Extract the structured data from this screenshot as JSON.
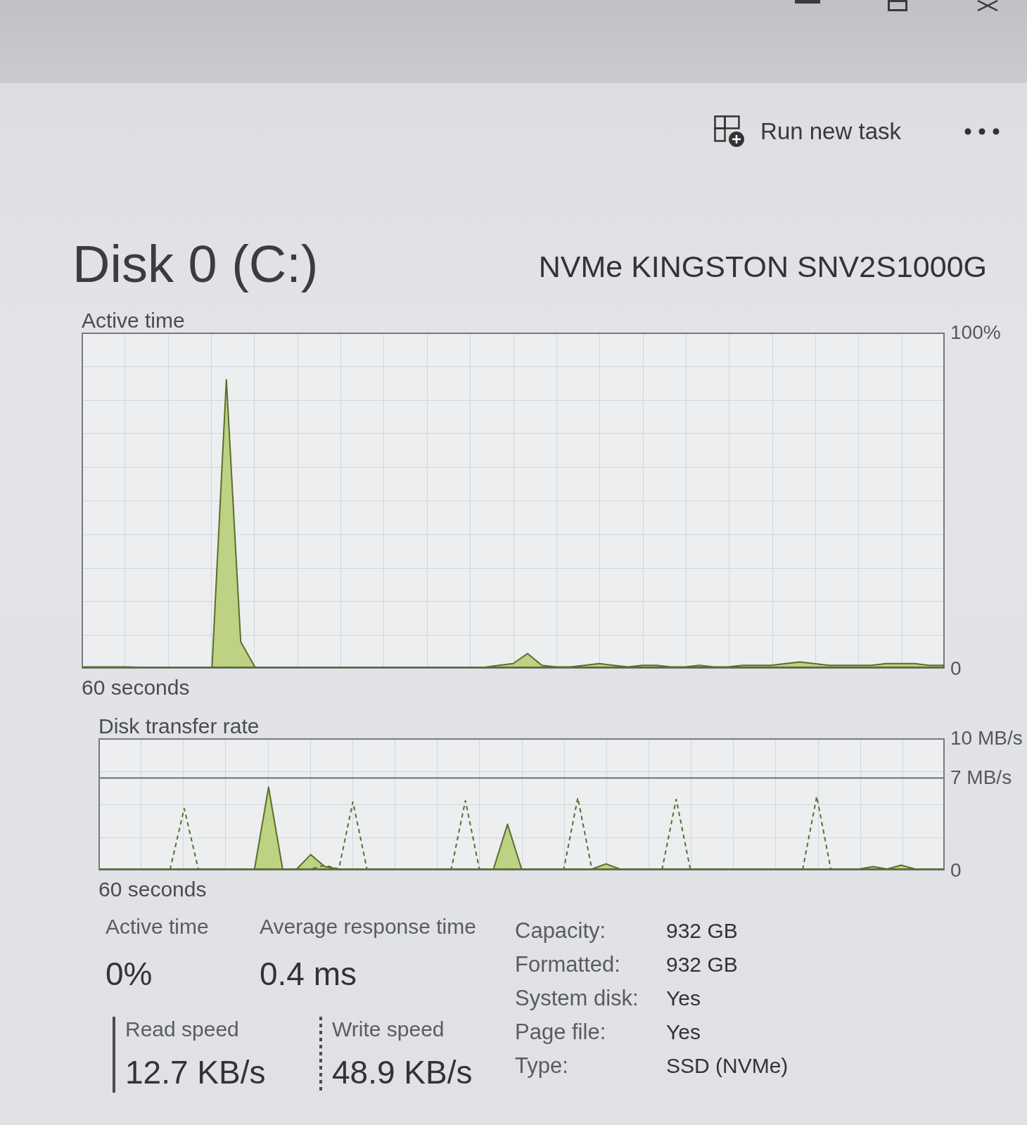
{
  "toolbar": {
    "run_task_label": "Run new task"
  },
  "header": {
    "title": "Disk 0 (C:)",
    "model": "NVMe KINGSTON SNV2S1000G"
  },
  "charts": [
    {
      "chart_data": {
        "type": "area",
        "title": "Active time",
        "xlabel": "60 seconds",
        "ylim": [
          0,
          100
        ],
        "yticks": [
          0,
          {
            "value": 100,
            "label": "100%"
          }
        ],
        "grid": true,
        "series": [
          {
            "values": [
              0.5,
              0.5,
              0.5,
              0.5,
              0.3,
              0,
              0,
              0,
              0,
              0,
              86,
              8,
              0,
              0,
              0.3,
              0.3,
              0,
              0,
              0,
              0,
              0,
              0,
              0,
              0,
              0,
              0,
              0,
              0,
              0,
              1,
              1.5,
              4.5,
              1,
              0.5,
              0.5,
              1,
              1.5,
              1,
              0.5,
              1,
              1,
              0.5,
              0.5,
              1,
              0.5,
              0.5,
              1,
              1,
              1,
              1.5,
              2,
              1.5,
              1,
              1,
              1,
              1,
              1.5,
              1.5,
              1.5,
              1,
              1
            ]
          }
        ]
      }
    },
    {
      "chart_data": {
        "type": "area",
        "title": "Disk transfer rate",
        "xlabel": "60 seconds",
        "ylim": [
          0,
          10
        ],
        "yticks": [
          0,
          {
            "value": 7,
            "label": "7 MB/s"
          },
          {
            "value": 10,
            "label": "10 MB/s"
          }
        ],
        "grid": true,
        "ref_lines": [
          {
            "axis": "y",
            "value": 7
          }
        ],
        "series": [
          {
            "type": "area",
            "values": [
              0,
              0,
              0,
              0,
              0,
              0,
              0,
              0,
              0,
              0,
              0,
              0,
              6.3,
              0,
              0,
              1.2,
              0.3,
              0,
              0,
              0,
              0,
              0,
              0,
              0,
              0,
              0,
              0,
              0,
              0,
              3.5,
              0,
              0,
              0,
              0,
              0,
              0,
              0.5,
              0,
              0,
              0,
              0,
              0,
              0,
              0,
              0,
              0,
              0,
              0,
              0,
              0,
              0,
              0,
              0,
              0,
              0,
              0.3,
              0,
              0.4,
              0,
              0,
              0
            ]
          },
          {
            "type": "line",
            "line_style": "dashed",
            "values": [
              0,
              0,
              0,
              0,
              0,
              0,
              4.7,
              0,
              0,
              0,
              0,
              0,
              0,
              0,
              0,
              0,
              0.4,
              0,
              5.2,
              0,
              0,
              0,
              0,
              0,
              0,
              0,
              5.3,
              0,
              0,
              0,
              0,
              0,
              0,
              0,
              5.5,
              0,
              0,
              0,
              0,
              0,
              0,
              5.4,
              0,
              0,
              0,
              0,
              0,
              0,
              0,
              0,
              0,
              5.6,
              0,
              0,
              0,
              0,
              0,
              0,
              0,
              0,
              0
            ]
          }
        ]
      }
    }
  ],
  "stats": [
    {
      "label": "Active time",
      "value": "0%"
    },
    {
      "label": "Average response time",
      "value": "0.4 ms"
    }
  ],
  "speeds": [
    {
      "kind": "solid",
      "label": "Read speed",
      "value": "12.7 KB/s"
    },
    {
      "kind": "dotted",
      "label": "Write speed",
      "value": "48.9 KB/s"
    }
  ],
  "properties": [
    {
      "label": "Capacity:",
      "value": "932 GB"
    },
    {
      "label": "Formatted:",
      "value": "932 GB"
    },
    {
      "label": "System disk:",
      "value": "Yes"
    },
    {
      "label": "Page file:",
      "value": "Yes"
    },
    {
      "label": "Type:",
      "value": "SSD (NVMe)"
    }
  ]
}
